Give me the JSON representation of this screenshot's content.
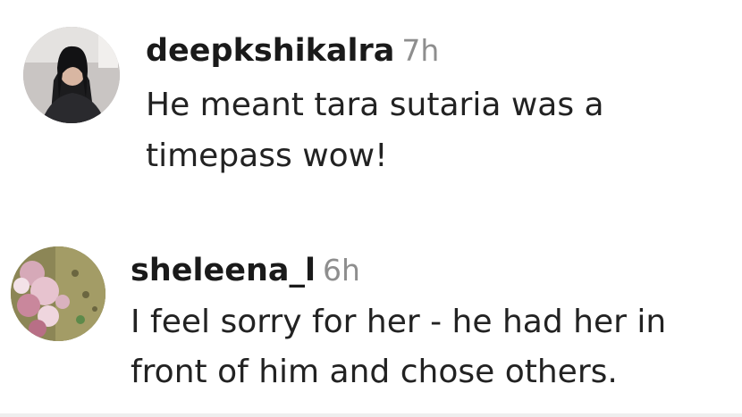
{
  "comments": [
    {
      "username": "deepkshikalra",
      "timestamp": "7h",
      "text_lines": [
        "He meant tara sutaria was a",
        "timepass wow!"
      ],
      "avatar_icon": "profile-photo-woman-dark-hair"
    },
    {
      "username": "sheleena_l",
      "timestamp": "6h",
      "text_lines": [
        "I feel sorry for her - he had her in",
        "front of him and chose others."
      ],
      "avatar_icon": "profile-photo-floral"
    }
  ],
  "colors": {
    "username": "#1a1a1a",
    "timestamp": "#8e8e8e",
    "text": "#222222",
    "background": "#ffffff"
  }
}
